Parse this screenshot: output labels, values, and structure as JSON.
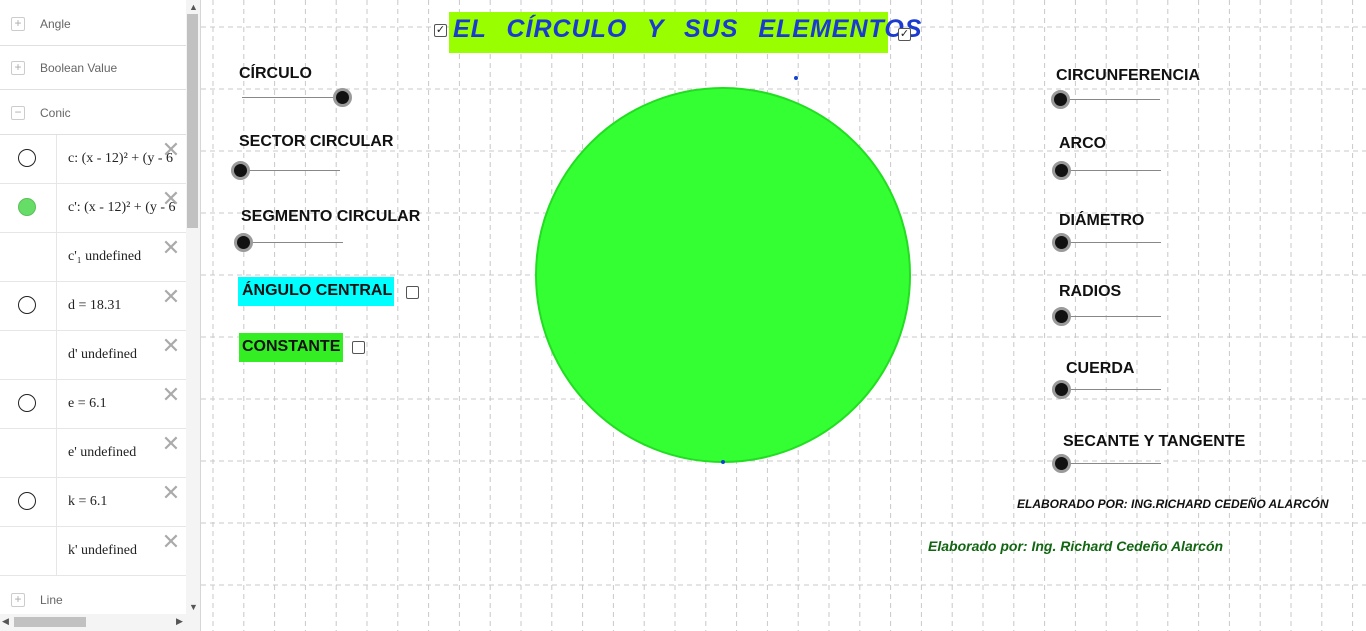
{
  "algebra": {
    "categories": {
      "angle": "Angle",
      "boolean": "Boolean Value",
      "conic": "Conic",
      "line": "Line"
    },
    "rows": [
      {
        "expr": "c: (x - 12)² + (y - 6",
        "marker": "outline"
      },
      {
        "expr": "c': (x - 12)² + (y - 6",
        "marker": "green"
      },
      {
        "expr": "c'₁ undefined",
        "marker": "none"
      },
      {
        "expr": "d = 18.31",
        "marker": "outline"
      },
      {
        "expr": "d' undefined",
        "marker": "none"
      },
      {
        "expr": "e = 6.1",
        "marker": "outline"
      },
      {
        "expr": "e' undefined",
        "marker": "none"
      },
      {
        "expr": "k = 6.1",
        "marker": "outline"
      },
      {
        "expr": "k' undefined",
        "marker": "none"
      }
    ],
    "delete_glyph": "✕"
  },
  "graphics": {
    "title": "EL CÍRCULO Y SUS ELEMENTOS",
    "checkbox_check": "✓",
    "title_checkbox_left_checked": true,
    "title_checkbox_right_checked": true,
    "left_sliders": [
      {
        "label": "CÍRCULO",
        "value": 1
      },
      {
        "label": "SECTOR CIRCULAR",
        "value": 0
      },
      {
        "label": "SEGMENTO CIRCULAR",
        "value": 0
      }
    ],
    "angulo_central": {
      "label": "ÁNGULO CENTRAL",
      "checked": false,
      "bg": "#00ffff"
    },
    "constante": {
      "label": "CONSTANTE",
      "checked": false,
      "bg": "#33ee22"
    },
    "right_sliders": [
      {
        "label": "CIRCUNFERENCIA",
        "value": 0
      },
      {
        "label": "ARCO",
        "value": 0
      },
      {
        "label": "DIÁMETRO",
        "value": 0
      },
      {
        "label": "RADIOS",
        "value": 0
      },
      {
        "label": "CUERDA",
        "value": 0
      },
      {
        "label": "SECANTE Y TANGENTE",
        "value": 0
      }
    ],
    "credit_upper": "ELABORADO POR: ING.RICHARD CEDEÑO ALARCÓN",
    "credit_lower": "Elaborado por: Ing. Richard Cedeño Alarcón",
    "circle_fill": "#33ff33",
    "circle_stroke": "#22dd22",
    "point_color": "#1144cc",
    "title_bg": "#99ff00",
    "title_color": "#1a3ad0"
  }
}
